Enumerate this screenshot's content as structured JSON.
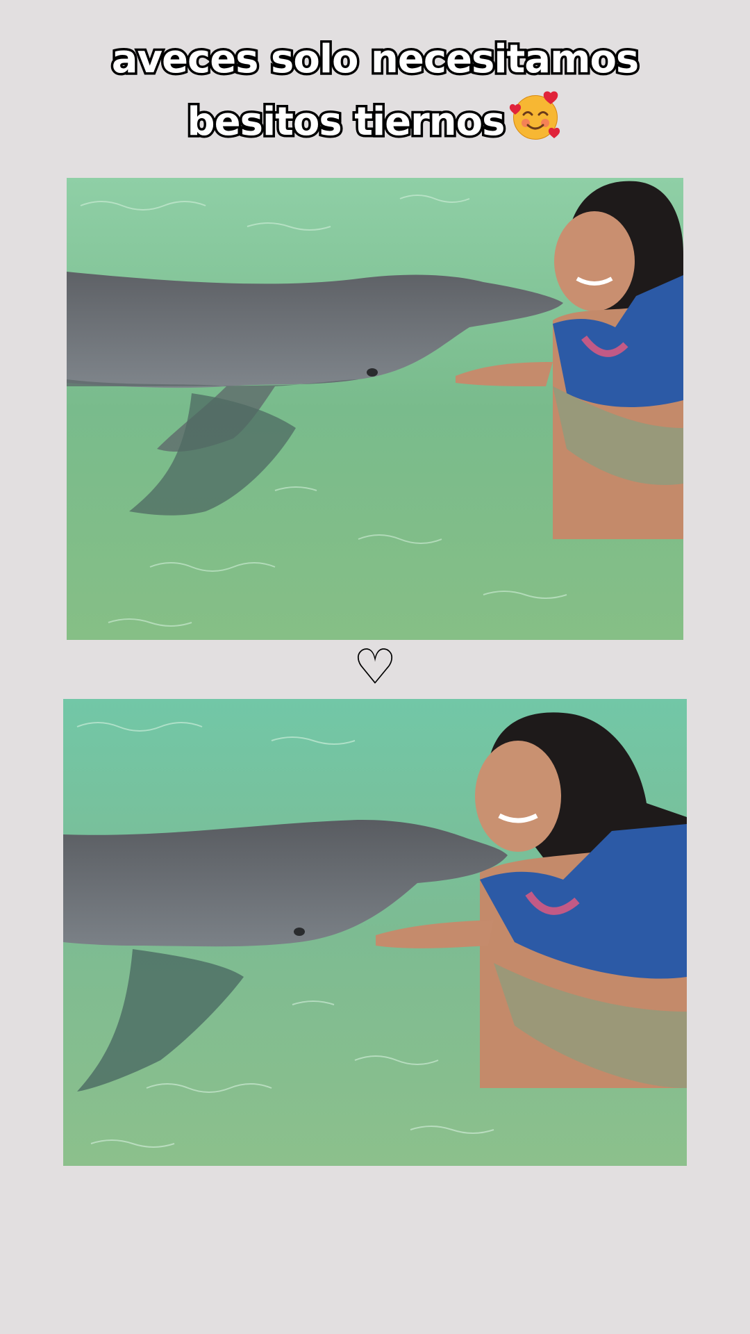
{
  "caption": {
    "line1": "aveces solo necesitamos",
    "line2": "besitos tiernos",
    "emoji": "smiling-face-with-hearts-icon"
  },
  "divider": {
    "symbol": "♡"
  },
  "photos": [
    {
      "description_name": "woman-kissing-dolphin-photo-top"
    },
    {
      "description_name": "woman-kissing-dolphin-photo-bottom"
    }
  ],
  "colors": {
    "background": "#e2dfe0",
    "water": "#7fbf95",
    "dolphin": "#6f7378",
    "vest": "#2c5aa6",
    "caption_fill": "#ffffff",
    "caption_stroke": "#000000"
  }
}
